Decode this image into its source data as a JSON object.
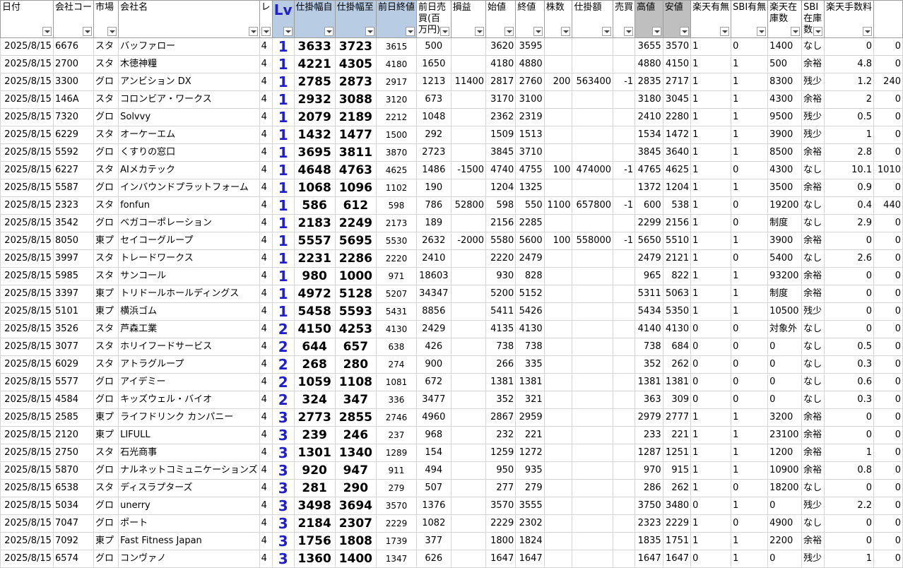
{
  "headers": [
    "日付",
    "会社コード",
    "市場",
    "会社名",
    "レ",
    "Lv",
    "仕掛幅自",
    "仕掛幅至",
    "前日終値",
    "前日売買(百万円)",
    "損益",
    "始値",
    "終値",
    "株数",
    "仕掛額",
    "売買",
    "高値",
    "安値",
    "楽天有無",
    "SBI有無",
    "楽天在庫数",
    "SBI在庫数",
    "楽天手数料",
    ""
  ],
  "header_visible": [
    "日付",
    "会社コー",
    "市場",
    "会社名",
    "レ",
    "Lv",
    "仕掛幅自",
    "仕掛幅至",
    "前日終値",
    "前日売買(百万円)",
    "損益",
    "始値",
    "終値",
    "株数",
    "仕掛額",
    "売買",
    "高値",
    "安値",
    "楽天有無",
    "SBI有無",
    "楽天在庫数",
    "SBI在庫数",
    "楽天手数料",
    ""
  ],
  "rows": [
    [
      "2025/8/15",
      "6676",
      "スタ",
      "バッファロー",
      "4",
      "1",
      "3633",
      "3723",
      "3615",
      "500",
      "",
      "3620",
      "3595",
      "",
      "",
      "",
      "3655",
      "3570",
      "1",
      "0",
      "1400",
      "なし",
      "0",
      "0"
    ],
    [
      "2025/8/15",
      "2700",
      "スタ",
      "木徳神糧",
      "4",
      "1",
      "4221",
      "4305",
      "4180",
      "1650",
      "",
      "4180",
      "4880",
      "",
      "",
      "",
      "4880",
      "4150",
      "1",
      "1",
      "500",
      "余裕",
      "4.8",
      "0"
    ],
    [
      "2025/8/15",
      "3300",
      "グロ",
      "アンビション DX",
      "4",
      "1",
      "2785",
      "2873",
      "2917",
      "1213",
      "11400",
      "2817",
      "2760",
      "200",
      "563400",
      "-1",
      "2835",
      "2717",
      "1",
      "1",
      "8300",
      "残少",
      "1.2",
      "240"
    ],
    [
      "2025/8/15",
      "146A",
      "スタ",
      "コロンビア・ワークス",
      "4",
      "1",
      "2932",
      "3088",
      "3120",
      "673",
      "",
      "3170",
      "3100",
      "",
      "",
      "",
      "3180",
      "3045",
      "1",
      "1",
      "4300",
      "余裕",
      "2",
      "0"
    ],
    [
      "2025/8/15",
      "7320",
      "グロ",
      "Solvvy",
      "4",
      "1",
      "2079",
      "2189",
      "2212",
      "1048",
      "",
      "2362",
      "2319",
      "",
      "",
      "",
      "2410",
      "2280",
      "1",
      "1",
      "9500",
      "残少",
      "0.5",
      "0"
    ],
    [
      "2025/8/15",
      "6229",
      "スタ",
      "オーケーエム",
      "4",
      "1",
      "1432",
      "1477",
      "1500",
      "292",
      "",
      "1509",
      "1513",
      "",
      "",
      "",
      "1534",
      "1472",
      "1",
      "1",
      "3900",
      "残少",
      "1",
      "0"
    ],
    [
      "2025/8/15",
      "5592",
      "グロ",
      "くすりの窓口",
      "4",
      "1",
      "3695",
      "3811",
      "3870",
      "2723",
      "",
      "3845",
      "3710",
      "",
      "",
      "",
      "3845",
      "3640",
      "1",
      "1",
      "8500",
      "余裕",
      "2.8",
      "0"
    ],
    [
      "2025/8/15",
      "6227",
      "スタ",
      "AIメカテック",
      "4",
      "1",
      "4648",
      "4763",
      "4625",
      "1486",
      "-1500",
      "4740",
      "4755",
      "100",
      "474000",
      "-1",
      "4765",
      "4625",
      "1",
      "0",
      "4300",
      "なし",
      "10.1",
      "1010"
    ],
    [
      "2025/8/15",
      "5587",
      "グロ",
      "インバウンドプラットフォーム",
      "4",
      "1",
      "1068",
      "1096",
      "1102",
      "190",
      "",
      "1204",
      "1325",
      "",
      "",
      "",
      "1372",
      "1204",
      "1",
      "1",
      "3500",
      "余裕",
      "0.9",
      "0"
    ],
    [
      "2025/8/15",
      "2323",
      "スタ",
      "fonfun",
      "4",
      "1",
      "586",
      "612",
      "598",
      "786",
      "52800",
      "598",
      "550",
      "1100",
      "657800",
      "-1",
      "600",
      "538",
      "1",
      "0",
      "19200",
      "なし",
      "0.4",
      "440"
    ],
    [
      "2025/8/15",
      "3542",
      "グロ",
      "ベガコーポレーション",
      "4",
      "1",
      "2183",
      "2249",
      "2173",
      "189",
      "",
      "2156",
      "2285",
      "",
      "",
      "",
      "2299",
      "2156",
      "1",
      "0",
      "制度",
      "なし",
      "2.9",
      "0"
    ],
    [
      "2025/8/15",
      "8050",
      "東プ",
      "セイコーグループ",
      "4",
      "1",
      "5557",
      "5695",
      "5530",
      "2632",
      "-2000",
      "5580",
      "5600",
      "100",
      "558000",
      "-1",
      "5650",
      "5510",
      "1",
      "1",
      "3900",
      "余裕",
      "0",
      "0"
    ],
    [
      "2025/8/15",
      "3997",
      "スタ",
      "トレードワークス",
      "4",
      "1",
      "2231",
      "2286",
      "2220",
      "2410",
      "",
      "2220",
      "2479",
      "",
      "",
      "",
      "2479",
      "2121",
      "1",
      "0",
      "5400",
      "なし",
      "2.6",
      "0"
    ],
    [
      "2025/8/15",
      "5985",
      "スタ",
      "サンコール",
      "4",
      "1",
      "980",
      "1000",
      "971",
      "18603",
      "",
      "930",
      "828",
      "",
      "",
      "",
      "965",
      "822",
      "1",
      "1",
      "93200",
      "余裕",
      "0",
      "0"
    ],
    [
      "2025/8/15",
      "3397",
      "東プ",
      "トリドールホールディングス",
      "4",
      "1",
      "4972",
      "5128",
      "5207",
      "34347",
      "",
      "5200",
      "5152",
      "",
      "",
      "",
      "5311",
      "5063",
      "1",
      "1",
      "制度",
      "余裕",
      "0",
      "0"
    ],
    [
      "2025/8/15",
      "5101",
      "東プ",
      "横浜ゴム",
      "4",
      "1",
      "5458",
      "5593",
      "5431",
      "8856",
      "",
      "5411",
      "5426",
      "",
      "",
      "",
      "5434",
      "5350",
      "1",
      "1",
      "10500",
      "残少",
      "0",
      "0"
    ],
    [
      "2025/8/15",
      "3526",
      "スタ",
      "芦森工業",
      "4",
      "2",
      "4150",
      "4253",
      "4130",
      "2429",
      "",
      "4135",
      "4130",
      "",
      "",
      "",
      "4140",
      "4130",
      "0",
      "0",
      "対象外",
      "なし",
      "0",
      "0"
    ],
    [
      "2025/8/15",
      "3077",
      "スタ",
      "ホリイフードサービス",
      "4",
      "2",
      "644",
      "657",
      "638",
      "426",
      "",
      "738",
      "738",
      "",
      "",
      "",
      "738",
      "684",
      "0",
      "0",
      "0",
      "なし",
      "0.5",
      "0"
    ],
    [
      "2025/8/15",
      "6029",
      "スタ",
      "アトラグループ",
      "4",
      "2",
      "268",
      "280",
      "274",
      "900",
      "",
      "266",
      "335",
      "",
      "",
      "",
      "352",
      "262",
      "0",
      "0",
      "0",
      "なし",
      "0.3",
      "0"
    ],
    [
      "2025/8/15",
      "5577",
      "グロ",
      "アイデミー",
      "4",
      "2",
      "1059",
      "1108",
      "1081",
      "672",
      "",
      "1381",
      "1381",
      "",
      "",
      "",
      "1381",
      "1381",
      "0",
      "0",
      "0",
      "なし",
      "0.6",
      "0"
    ],
    [
      "2025/8/15",
      "4584",
      "グロ",
      "キッズウェル・バイオ",
      "4",
      "2",
      "324",
      "347",
      "336",
      "3477",
      "",
      "352",
      "321",
      "",
      "",
      "",
      "363",
      "309",
      "0",
      "0",
      "0",
      "なし",
      "0.3",
      "0"
    ],
    [
      "2025/8/15",
      "2585",
      "東プ",
      "ライフドリンク カンパニー",
      "4",
      "3",
      "2773",
      "2855",
      "2746",
      "4960",
      "",
      "2867",
      "2959",
      "",
      "",
      "",
      "2979",
      "2777",
      "1",
      "1",
      "3200",
      "余裕",
      "0",
      "0"
    ],
    [
      "2025/8/15",
      "2120",
      "東プ",
      "LIFULL",
      "4",
      "3",
      "239",
      "246",
      "237",
      "968",
      "",
      "232",
      "221",
      "",
      "",
      "",
      "233",
      "221",
      "1",
      "1",
      "23100",
      "余裕",
      "0",
      "0"
    ],
    [
      "2025/8/15",
      "2750",
      "スタ",
      "石光商事",
      "4",
      "3",
      "1301",
      "1340",
      "1289",
      "154",
      "",
      "1259",
      "1272",
      "",
      "",
      "",
      "1287",
      "1251",
      "1",
      "1",
      "1200",
      "余裕",
      "1",
      "0"
    ],
    [
      "2025/8/15",
      "5870",
      "グロ",
      "ナルネットコミュニケーションズ",
      "4",
      "3",
      "920",
      "947",
      "911",
      "494",
      "",
      "950",
      "935",
      "",
      "",
      "",
      "970",
      "915",
      "1",
      "1",
      "10900",
      "余裕",
      "0.8",
      "0"
    ],
    [
      "2025/8/15",
      "6538",
      "スタ",
      "ディスラプターズ",
      "4",
      "3",
      "281",
      "290",
      "279",
      "507",
      "",
      "277",
      "279",
      "",
      "",
      "",
      "286",
      "262",
      "1",
      "0",
      "18200",
      "なし",
      "0",
      "0"
    ],
    [
      "2025/8/15",
      "5034",
      "グロ",
      "unerry",
      "4",
      "3",
      "3498",
      "3694",
      "3570",
      "1376",
      "",
      "3570",
      "3555",
      "",
      "",
      "",
      "3750",
      "3480",
      "0",
      "1",
      "0",
      "残少",
      "2.2",
      "0"
    ],
    [
      "2025/8/15",
      "7047",
      "グロ",
      "ポート",
      "4",
      "3",
      "2184",
      "2307",
      "2229",
      "1082",
      "",
      "2229",
      "2302",
      "",
      "",
      "",
      "2323",
      "2229",
      "1",
      "0",
      "4900",
      "なし",
      "0",
      "0"
    ],
    [
      "2025/8/15",
      "7092",
      "東プ",
      "Fast Fitness Japan",
      "4",
      "3",
      "1756",
      "1808",
      "1739",
      "377",
      "",
      "1800",
      "1824",
      "",
      "",
      "",
      "1835",
      "1751",
      "1",
      "1",
      "2200",
      "余裕",
      "0",
      "0"
    ],
    [
      "2025/8/15",
      "6574",
      "グロ",
      "コンヴァノ",
      "4",
      "3",
      "1360",
      "1400",
      "1347",
      "626",
      "",
      "1647",
      "1647",
      "",
      "",
      "",
      "1647",
      "1647",
      "0",
      "1",
      "0",
      "残少",
      "1",
      "0"
    ]
  ]
}
